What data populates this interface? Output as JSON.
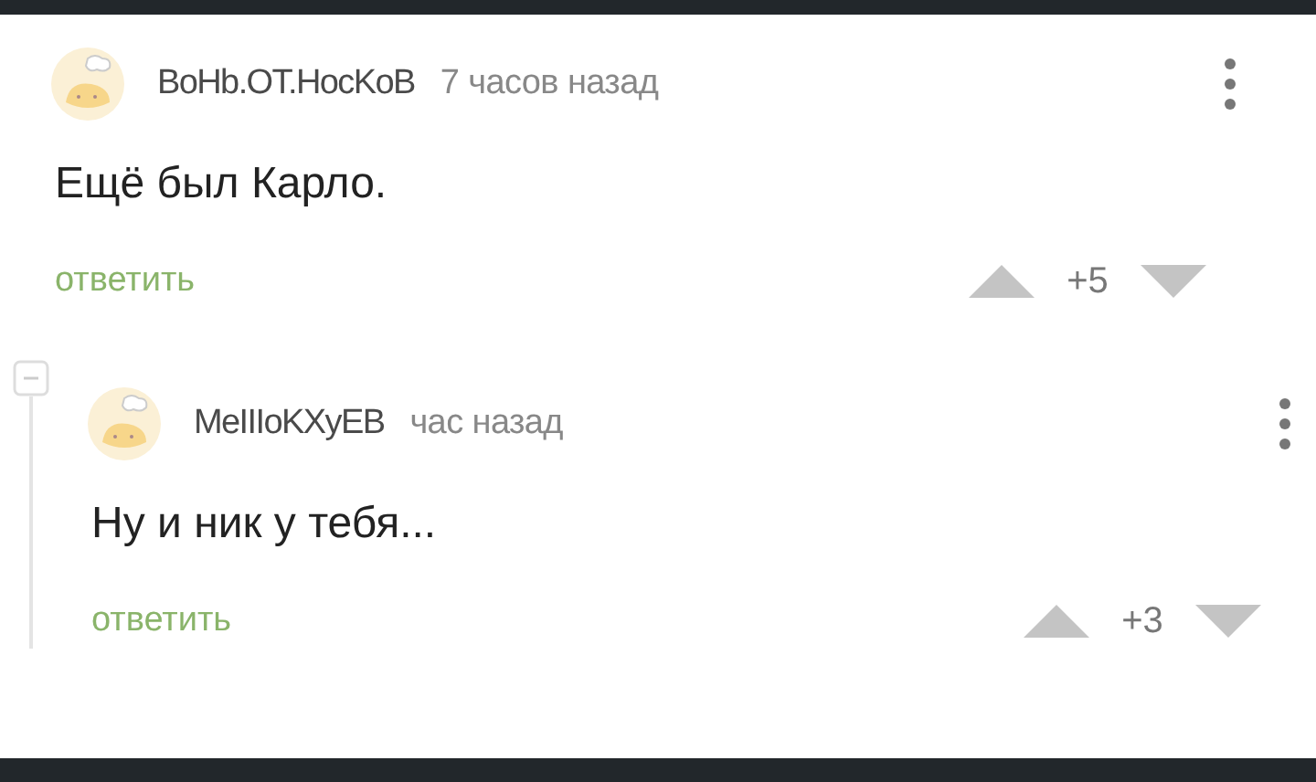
{
  "comments": [
    {
      "author": "BoHb.OT.HocKoB",
      "time": "7 часов назад",
      "text": "Ещё был Карло.",
      "reply": "ответить",
      "score": "+5",
      "children": [
        {
          "author": "MeIIIoKXyEB",
          "time": "час назад",
          "text": "Ну и ник у тебя...",
          "reply": "ответить",
          "score": "+3"
        }
      ],
      "expanded": true
    }
  ]
}
